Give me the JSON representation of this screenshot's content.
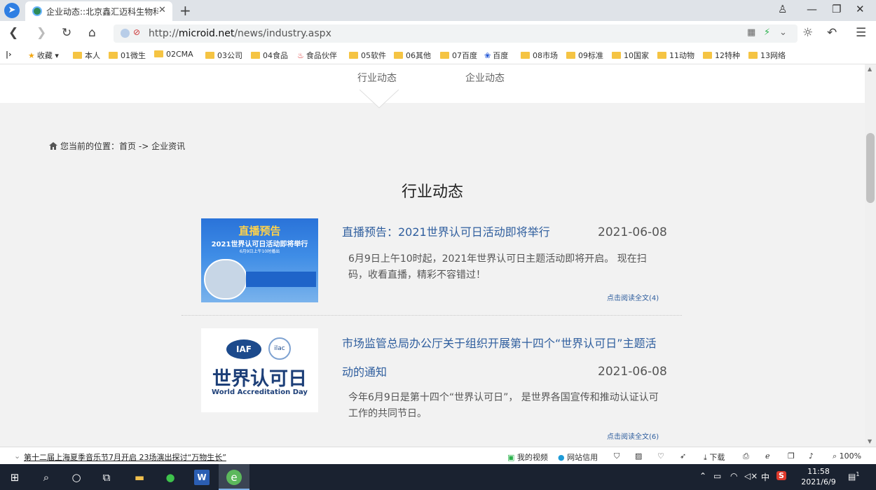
{
  "browser": {
    "tab_title": "企业动态::北京鑫汇迈科生物科技",
    "url_prefix": "http://",
    "url_domain": "microid.net",
    "url_path": "/news/industry.aspx",
    "bookmarks": [
      "收藏",
      "本人",
      "01微生",
      "02CMA",
      "03公司",
      "04食品",
      "食品伙伴",
      "05软件",
      "06其他",
      "07百度",
      "百度",
      "08市场",
      "09标准",
      "10国家",
      "11动物",
      "12特种",
      "13网络"
    ]
  },
  "page": {
    "subnav": [
      "行业动态",
      "企业动态"
    ],
    "breadcrumb_label": "您当前的位置：",
    "breadcrumb_home": "首页",
    "breadcrumb_sep": "->",
    "breadcrumb_current": "企业资讯",
    "section_title": "行业动态",
    "news": [
      {
        "title": "直播预告：2021世界认可日活动即将举行",
        "date": "2021-06-08",
        "desc": "6月9日上午10时起，2021年世界认可日主题活动即将开启。 现在扫码，收看直播，精彩不容错过！",
        "more": "点击阅读全文(4)",
        "thumb_top": "直播预告",
        "thumb_mid": "2021世界认可日活动即将举行",
        "thumb_small": "6月9日上午10时播出"
      },
      {
        "title": "市场监管总局办公厅关于组织开展第十四个“世界认可日”主题活动的通知",
        "date": "2021-06-08",
        "desc": "今年6月9日是第十四个“世界认可日”， 是世界各国宣传和推动认证认可工作的共同节日。",
        "more": "点击阅读全文(6)",
        "thumb_logo_1": "IAF",
        "thumb_logo_2": "ilac",
        "thumb_cn": "世界认可日",
        "thumb_en": "World Accreditation Day"
      }
    ]
  },
  "statusbar": {
    "news_ticker": "第十二届上海夏季音乐节7月开启 23场演出探讨“万物生长”",
    "my_video": "我的视频",
    "credit": "网站信用",
    "download": "下载",
    "zoom": "100%"
  },
  "taskbar": {
    "ime": "中",
    "time": "11:58",
    "date": "2021/6/9",
    "notifications": "1"
  }
}
